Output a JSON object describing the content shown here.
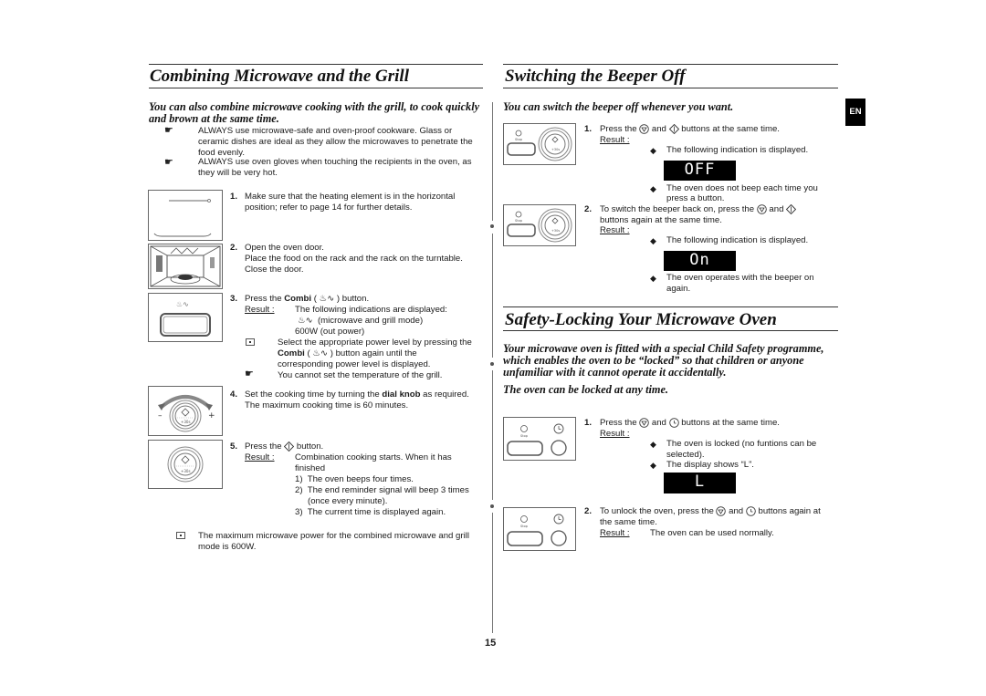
{
  "page_number": "15",
  "language_tab": "EN",
  "left": {
    "title": "Combining Microwave and the Grill",
    "intro": "You can also combine microwave cooking with the grill, to cook quickly and brown at the same time.",
    "tips": [
      "ALWAYS use microwave-safe and oven-proof cookware. Glass or ceramic dishes are ideal as they allow the microwaves to penetrate the food evenly.",
      "ALWAYS use oven gloves when touching the recipients in the oven, as they will be very hot."
    ],
    "steps": [
      {
        "num": "1.",
        "text": "Make sure that the heating element is in the horizontal position; refer to page 14 for further details."
      },
      {
        "num": "2.",
        "text_a": "Open the oven door.",
        "text_b": "Place the food on the rack and the rack on the turntable.",
        "text_c": "Close the door."
      },
      {
        "num": "3.",
        "text_pre": "Press the ",
        "text_bold": "Combi",
        "text_post": " button.",
        "result_label": "Result :",
        "result_line1": "The following indications are displayed:",
        "result_line2": "(microwave and grill mode)",
        "result_line3": "600W (out power)",
        "note_pre": "Select the appropriate power level by pressing the",
        "note_bold": "Combi",
        "note_post": "button again until the",
        "note_line3": "corresponding power level is displayed.",
        "tip": "You cannot set the temperature of the grill."
      },
      {
        "num": "4.",
        "text_pre": "Set the cooking time by turning the ",
        "text_bold": "dial knob",
        "text_post": " as required.",
        "text_line2": "The maximum cooking time is 60 minutes."
      },
      {
        "num": "5.",
        "text_pre": "Press the",
        "text_post": "button.",
        "result_label": "Result :",
        "result_line1": "Combination cooking starts. When it has",
        "result_line2": "finished",
        "sub": [
          {
            "n": "1)",
            "t": "The oven beeps four times."
          },
          {
            "n": "2)",
            "t": "The end reminder signal will beep 3 times"
          },
          {
            "n": "",
            "t": "(once every minute)."
          },
          {
            "n": "3)",
            "t": "The current time is displayed again."
          }
        ]
      }
    ],
    "final_note_line1": "The maximum microwave power for the combined microwave and grill",
    "final_note_line2": "mode is 600W."
  },
  "right_top": {
    "title": "Switching the Beeper Off",
    "intro": "You can switch the beeper off whenever you want.",
    "step1": {
      "num": "1.",
      "pre": "Press the",
      "mid": "and",
      "post": "buttons at the same time.",
      "result_label": "Result :",
      "bullet1": "The following indication is displayed.",
      "display": "OFF",
      "bullet2_line1": "The oven does not beep each time you",
      "bullet2_line2": "press a button."
    },
    "step2": {
      "num": "2.",
      "line1_pre": "To switch the beeper back on, press the",
      "line1_mid": "and",
      "line2": "buttons again at the same time.",
      "result_label": "Result :",
      "bullet1": "The following indication is displayed.",
      "display": "On",
      "bullet2_line1": "The oven operates with the beeper on",
      "bullet2_line2": "again."
    }
  },
  "right_bottom": {
    "title": "Safety-Locking Your Microwave Oven",
    "intro_line1": "Your microwave oven is fitted with a special Child Safety programme,",
    "intro_line2": "which enables the oven to be “locked” so that children or anyone",
    "intro_line3": "unfamiliar with it cannot operate it accidentally.",
    "intro2": "The oven can be locked at any time.",
    "step1": {
      "num": "1.",
      "pre": "Press the",
      "mid": "and",
      "post": "buttons at the same time.",
      "result_label": "Result :",
      "bullet1_line1": "The oven is locked (no funtions can be",
      "bullet1_line2": "selected).",
      "bullet2": "The display shows “L”.",
      "display": "L"
    },
    "step2": {
      "num": "2.",
      "pre": "To unlock the oven, press the",
      "mid": "and",
      "post": "buttons again at",
      "line2": "the same time.",
      "result_label": "Result :",
      "result_text": "The oven can be used normally."
    }
  },
  "figure_labels": {
    "stop": "Stop",
    "plus30": "+30s",
    "minus": "–",
    "plus": "+"
  },
  "icons": {
    "hand": "☛",
    "diamond": "◆"
  }
}
